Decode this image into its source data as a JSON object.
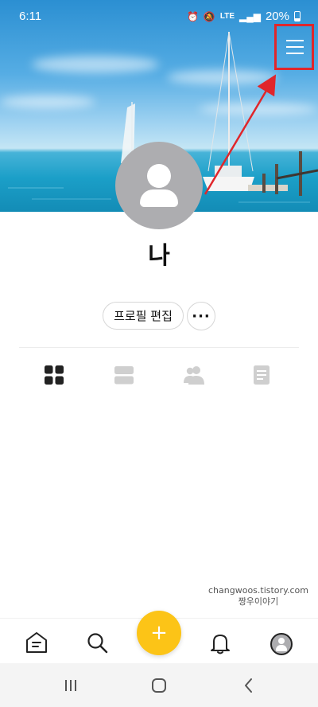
{
  "status_bar": {
    "time": "6:11",
    "network": "LTE",
    "battery": "20%"
  },
  "profile": {
    "name": "나",
    "edit_label": "프로필 편집",
    "more_label": "···"
  },
  "tabs": [
    {
      "icon": "grid-icon",
      "active": true
    },
    {
      "icon": "list-icon",
      "active": false
    },
    {
      "icon": "friends-icon",
      "active": false
    },
    {
      "icon": "document-icon",
      "active": false
    }
  ],
  "watermark": {
    "line1": "changwoos.tistory.com",
    "line2": "짱우이야기"
  },
  "bottom_nav": {
    "fab_label": "+",
    "items": [
      "home-icon",
      "search-icon",
      "add-button",
      "bell-icon",
      "profile-avatar"
    ]
  },
  "colors": {
    "accent": "#fcc417",
    "highlight": "#e0262b",
    "avatar_placeholder": "#adadb0"
  }
}
